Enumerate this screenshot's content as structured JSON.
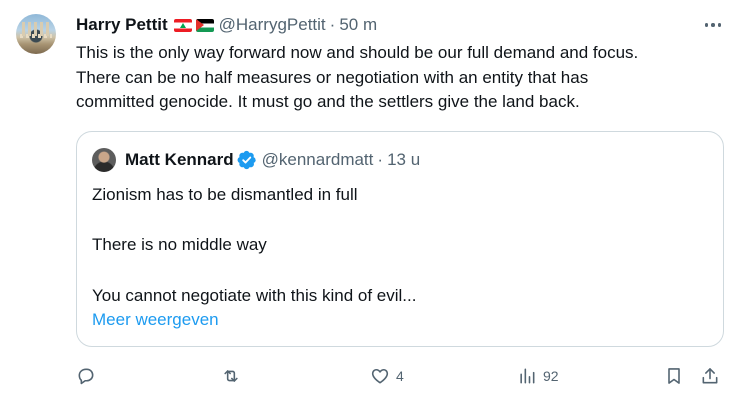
{
  "tweet": {
    "author": {
      "display_name": "Harry Pettit",
      "flags": [
        "lebanon-flag",
        "palestine-flag"
      ],
      "handle": "@HarrygPettit",
      "separator": "·",
      "time": "50 m"
    },
    "text": "This is the only way forward now and should be our full demand and focus.\nThere can be no half measures or negotiation with an entity that has\ncommitted genocide. It must go and the settlers give the land back.",
    "quote": {
      "author": {
        "display_name": "Matt Kennard",
        "verified": true,
        "handle": "@kennardmatt",
        "separator": "·",
        "time": "13 u"
      },
      "lines": [
        "Zionism has to be dismantled in full",
        "There is no middle way",
        "You cannot negotiate with this kind of evil..."
      ],
      "show_more": "Meer weergeven"
    },
    "actions": {
      "reply": {
        "icon": "reply-icon",
        "count": ""
      },
      "retweet": {
        "icon": "retweet-icon",
        "count": ""
      },
      "like": {
        "icon": "heart-icon",
        "count": "4"
      },
      "views": {
        "icon": "views-icon",
        "count": "92"
      },
      "bookmark": {
        "icon": "bookmark-icon"
      },
      "share": {
        "icon": "share-icon"
      }
    }
  },
  "colors": {
    "text": "#0f1419",
    "secondary": "#536471",
    "link": "#1d9bf0",
    "border": "#cfd9de",
    "verified": "#1d9bf0"
  }
}
